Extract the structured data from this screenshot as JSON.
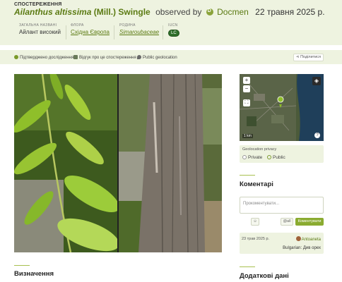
{
  "header": {
    "kicker": "СПОСТЕРЕЖЕННЯ",
    "scientific_name": "Ailanthus altissima",
    "authority": "(Mill.) Swingle",
    "observed_by": "observed by",
    "user": "Docmen",
    "date": "22 травня 2025 р."
  },
  "meta": {
    "common_label": "ЗАГАЛЬНА НАЗВАНІ",
    "common_value": "Айлант високий",
    "flora_label": "ФЛОРА",
    "flora_value": "Східна Європа",
    "family_label": "РОДИНА",
    "family_value": "Simaroubaceae",
    "iucn_label": "IUCN",
    "iucn_value": "LC"
  },
  "status": {
    "confirmed": "Підтверджено дослідження",
    "feedback": "Відгук про це спостереження",
    "geo": "Public geolocation",
    "share": "Поділитися"
  },
  "map": {
    "scale": "1 km",
    "zoom_in": "+",
    "zoom_out": "−"
  },
  "geolocation": {
    "label": "Geolocation privacy",
    "private": "Private",
    "public": "Public",
    "selected": "Public"
  },
  "sections": {
    "identification": "Визначення",
    "comments": "Коментарі",
    "extra_data": "Додаткові дані"
  },
  "comment_form": {
    "placeholder": "Прокоментувати...",
    "emoji_button": "☺",
    "mention_button": "@all",
    "submit": "Коментувати"
  },
  "comment": {
    "date": "23 трав 2025 р.",
    "author": "Antoaneta",
    "text": "Bulgarian: Див орех"
  },
  "colors": {
    "accent": "#5b7a12",
    "panel": "#eef3e0",
    "button": "#8aab30"
  }
}
